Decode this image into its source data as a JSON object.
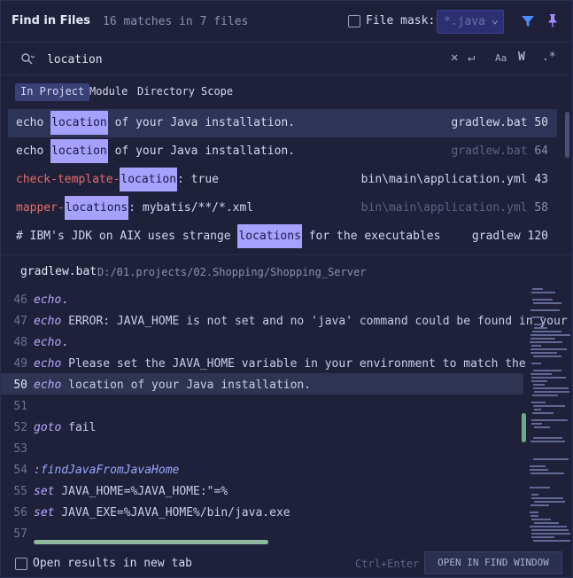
{
  "header": {
    "title": "Find in Files",
    "match_count": "16 matches in 7 files",
    "file_mask_label": "File mask:",
    "file_mask_value": "*.java"
  },
  "search": {
    "query": "location"
  },
  "scope_tabs": [
    {
      "label": "In Project",
      "active": true
    },
    {
      "label": "Module",
      "active": false
    },
    {
      "label": "Directory",
      "active": false
    },
    {
      "label": "Scope",
      "active": false
    }
  ],
  "results": [
    {
      "pre": "echo ",
      "match": "location",
      "post": " of your Java installation.",
      "file": "gradlew.bat",
      "line": "50",
      "selected": true,
      "dim_file": false
    },
    {
      "pre": "echo ",
      "match": "location",
      "post": " of your Java installation.",
      "file": "gradlew.bat",
      "line": "64",
      "selected": false,
      "dim_file": true
    },
    {
      "pre": "check-template-",
      "match": "location",
      "post": ": true",
      "file": "bin\\main\\application.yml",
      "line": "43",
      "selected": false,
      "dim_file": false,
      "red_pre": true
    },
    {
      "pre": "mapper-",
      "match": "locations",
      "post": ": mybatis/**/*.xml",
      "file": "bin\\main\\application.yml",
      "line": "58",
      "selected": false,
      "dim_file": true,
      "red_pre": true
    },
    {
      "pre": "# IBM's JDK on AIX uses strange ",
      "match": "locations",
      "post": " for the executables",
      "file": "gradlew",
      "line": "120",
      "selected": false,
      "dim_file": false
    }
  ],
  "preview": {
    "file": "gradlew.bat",
    "path": "D:/01.projects/02.Shopping/Shopping_Server"
  },
  "code_lines": [
    {
      "num": "46",
      "kw": "echo",
      "rest": "."
    },
    {
      "num": "47",
      "kw": "echo",
      "rest": " ERROR: JAVA_HOME is not set and no 'java' command could be found in your P"
    },
    {
      "num": "48",
      "kw": "echo",
      "rest": "."
    },
    {
      "num": "49",
      "kw": "echo",
      "rest": " Please set the JAVA_HOME variable in your environment to match the"
    },
    {
      "num": "50",
      "kw": "echo",
      "rest": " location of your Java installation.",
      "current": true
    },
    {
      "num": "51",
      "kw": "",
      "rest": ""
    },
    {
      "num": "52",
      "kw": "goto",
      "rest": " fail"
    },
    {
      "num": "53",
      "kw": "",
      "rest": ""
    },
    {
      "num": "54",
      "kw": "",
      "rest": "",
      "label": ":findJavaFromJavaHome"
    },
    {
      "num": "55",
      "kw": "set",
      "rest": " JAVA_HOME=%JAVA_HOME:\"=%"
    },
    {
      "num": "56",
      "kw": "set",
      "rest": " JAVA_EXE=%JAVA_HOME%/bin/java.exe"
    },
    {
      "num": "57",
      "kw": "",
      "rest": ""
    }
  ],
  "footer": {
    "open_new_tab_label": "Open results in new tab",
    "shortcut": "Ctrl+Enter",
    "open_button_label": "OPEN IN FIND WINDOW"
  },
  "colors": {
    "background": "#1e2139",
    "match_highlight": "#a6a0ff",
    "keyword": "#b7a8ff",
    "accent_blue": "#4f8cff",
    "pin_violet": "#a88bff"
  }
}
